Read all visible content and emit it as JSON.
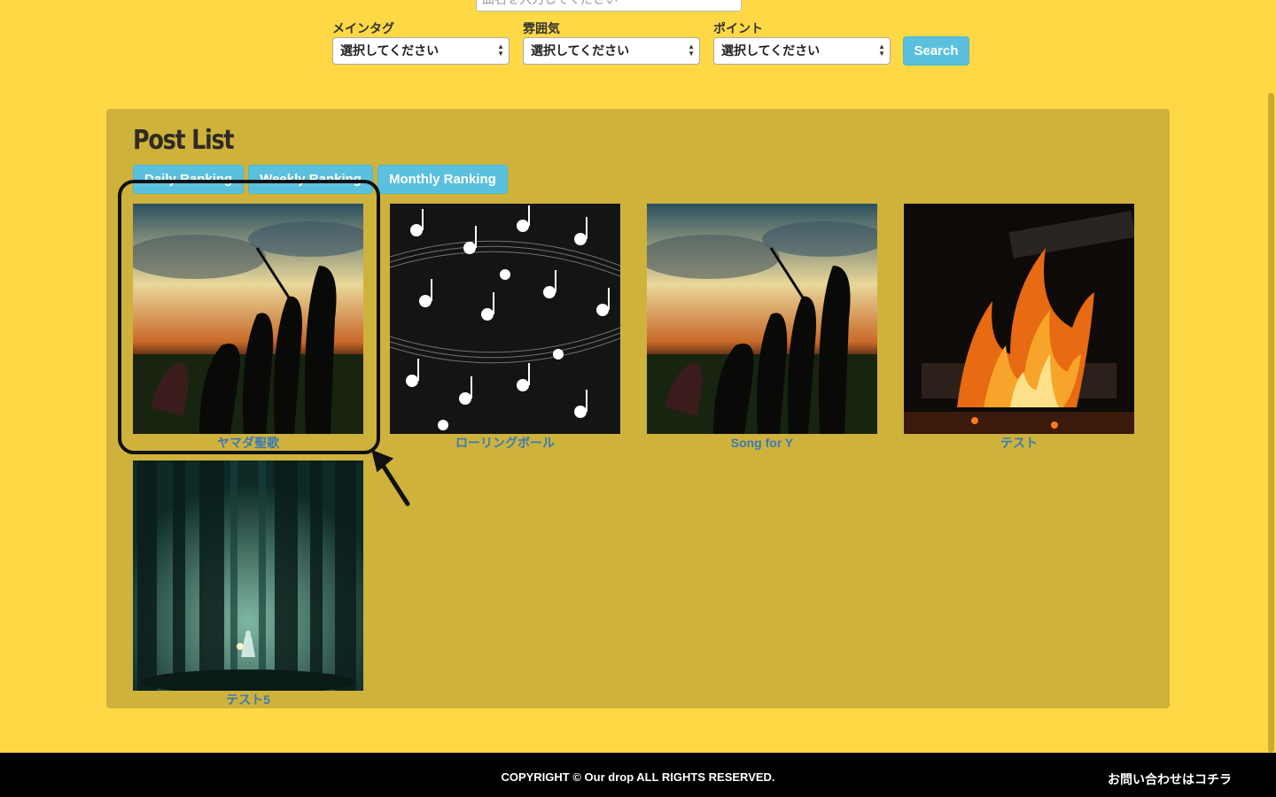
{
  "search": {
    "placeholder": "曲名を入力してください"
  },
  "filters": [
    {
      "label": "メインタグ",
      "selected": "選択してください"
    },
    {
      "label": "雰囲気",
      "selected": "選択してください"
    },
    {
      "label": "ポイント",
      "selected": "選択してください"
    }
  ],
  "search_button": "Search",
  "panel": {
    "title": "Post List",
    "tabs": [
      "Daily Ranking",
      "Weekly Ranking",
      "Monthly Ranking"
    ]
  },
  "posts": [
    {
      "title": "ヤマダ聖歌",
      "image": "evolution-silhouette-sunset"
    },
    {
      "title": "ローリングボール",
      "image": "music-notes-pattern"
    },
    {
      "title": "Song for Y",
      "image": "evolution-silhouette-sunset"
    },
    {
      "title": "テスト",
      "image": "campfire"
    },
    {
      "title": "テスト5",
      "image": "misty-forest-girl"
    }
  ],
  "footer": {
    "copyright": "COPYRIGHT © Our drop ALL RIGHTS RESERVED.",
    "contact": "お問い合わせはコチラ"
  }
}
